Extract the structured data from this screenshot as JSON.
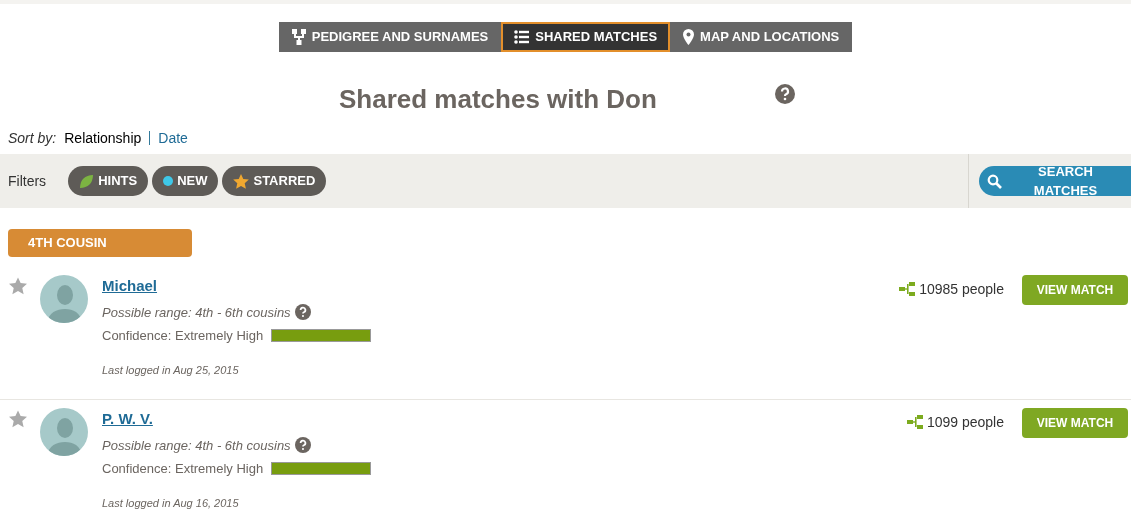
{
  "tabs": [
    {
      "label": "PEDIGREE AND SURNAMES",
      "kind": "pedigree",
      "selected": false
    },
    {
      "label": "SHARED MATCHES",
      "kind": "list",
      "selected": true
    },
    {
      "label": "MAP AND LOCATIONS",
      "kind": "pin",
      "selected": false
    }
  ],
  "title": "Shared matches with Don",
  "sort": {
    "label": "Sort by:",
    "options": [
      {
        "label": "Relationship",
        "selected": true
      },
      {
        "label": "Date",
        "selected": false
      }
    ]
  },
  "filters": {
    "label": "Filters",
    "items": [
      {
        "label": "HINTS",
        "kind": "leaf"
      },
      {
        "label": "NEW",
        "kind": "dot"
      },
      {
        "label": "STARRED",
        "kind": "star"
      }
    ],
    "search_button": "SEARCH MATCHES"
  },
  "group": "4TH COUSIN",
  "matches": [
    {
      "name": "Michael",
      "starred": false,
      "range": "Possible range: 4th - 6th cousins",
      "confidence": "Confidence: Extremely High",
      "level": 1,
      "last_login": "Last logged in Aug 25, 2015",
      "tree": "10985 people",
      "button": "VIEW MATCH"
    },
    {
      "name": "P. W. V.",
      "starred": false,
      "range": "Possible range: 4th - 6th cousins",
      "confidence": "Confidence: Extremely High",
      "level": 1,
      "last_login": "Last logged in Aug 16, 2015",
      "tree": "1099 people",
      "button": "VIEW MATCH"
    }
  ]
}
